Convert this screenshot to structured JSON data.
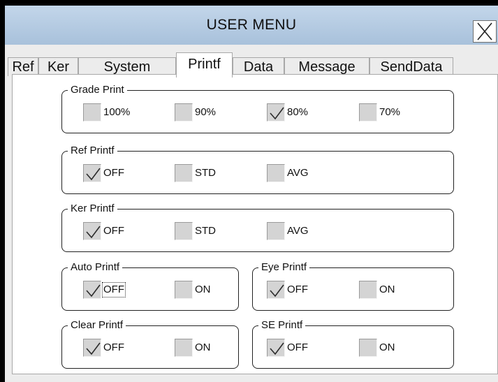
{
  "window": {
    "title": "USER MENU"
  },
  "tabs": [
    {
      "label": "Ref",
      "active": false
    },
    {
      "label": "Ker",
      "active": false
    },
    {
      "label": "System",
      "active": false
    },
    {
      "label": "Printf",
      "active": true
    },
    {
      "label": "Data",
      "active": false
    },
    {
      "label": "Message",
      "active": false
    },
    {
      "label": "SendData",
      "active": false
    }
  ],
  "groups": {
    "grade_print": {
      "title": "Grade Print",
      "options": [
        {
          "label": "100%",
          "checked": false
        },
        {
          "label": "90%",
          "checked": false
        },
        {
          "label": "80%",
          "checked": true
        },
        {
          "label": "70%",
          "checked": false
        }
      ]
    },
    "ref_printf": {
      "title": "Ref Printf",
      "options": [
        {
          "label": "OFF",
          "checked": true
        },
        {
          "label": "STD",
          "checked": false
        },
        {
          "label": "AVG",
          "checked": false
        }
      ]
    },
    "ker_printf": {
      "title": "Ker Printf",
      "options": [
        {
          "label": "OFF",
          "checked": true
        },
        {
          "label": "STD",
          "checked": false
        },
        {
          "label": "AVG",
          "checked": false
        }
      ]
    },
    "auto_printf": {
      "title": "Auto Printf",
      "options": [
        {
          "label": "OFF",
          "checked": true
        },
        {
          "label": "ON",
          "checked": false
        }
      ]
    },
    "eye_printf": {
      "title": "Eye Printf",
      "options": [
        {
          "label": "OFF",
          "checked": true
        },
        {
          "label": "ON",
          "checked": false
        }
      ]
    },
    "clear_printf": {
      "title": "Clear Printf",
      "options": [
        {
          "label": "OFF",
          "checked": true
        },
        {
          "label": "ON",
          "checked": false
        }
      ]
    },
    "se_printf": {
      "title": "SE Printf",
      "options": [
        {
          "label": "OFF",
          "checked": true
        },
        {
          "label": "ON",
          "checked": false
        }
      ]
    }
  },
  "icons": {
    "close": "close-icon",
    "check": "checkmark-icon"
  },
  "colors": {
    "titlebar": "#b6cde4",
    "checkbox": "#d4d4d4",
    "check": "#2b2b2b"
  }
}
